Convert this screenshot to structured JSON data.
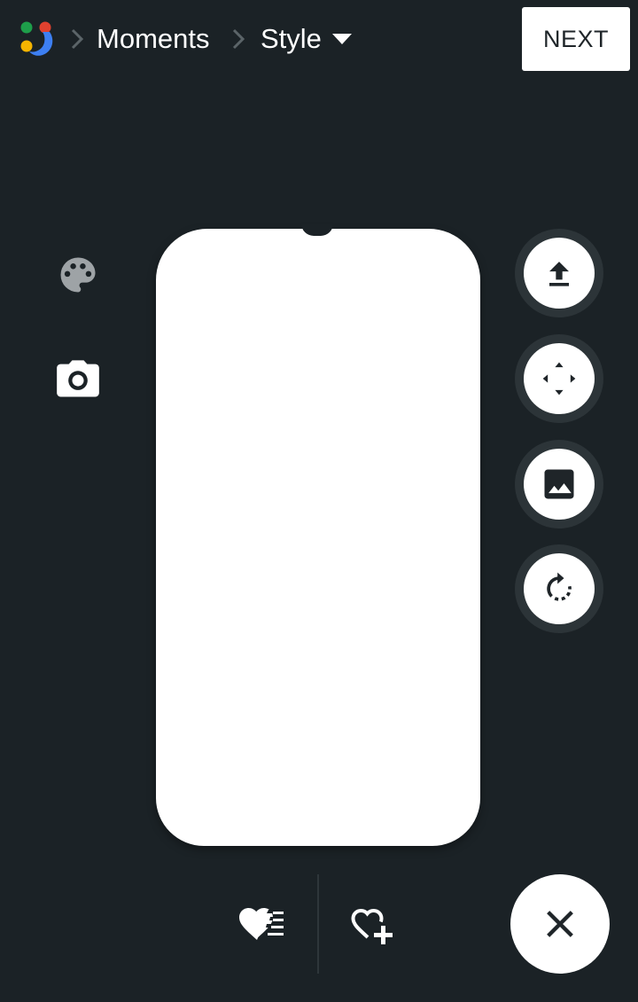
{
  "header": {
    "logo_icon": "app-logo-icon",
    "breadcrumb": [
      {
        "label": "Moments"
      },
      {
        "label": "Style",
        "has_dropdown": true
      }
    ],
    "next_label": "NEXT"
  },
  "left_tools": [
    {
      "icon": "palette-icon"
    },
    {
      "icon": "camera-icon"
    }
  ],
  "right_tools": [
    {
      "icon": "upload-icon"
    },
    {
      "icon": "move-arrows-icon"
    },
    {
      "icon": "image-icon"
    },
    {
      "icon": "rotate-icon"
    }
  ],
  "bottom_bar": {
    "icons": [
      "favorites-list-icon",
      "add-favorite-icon"
    ],
    "close_icon": "close-icon"
  },
  "colors": {
    "background": "#1b2226",
    "tool_ring": "#2c3438",
    "foreground": "#ffffff",
    "logo_green": "#1e9e4a",
    "logo_red": "#e0412f",
    "logo_yellow": "#f5b400",
    "logo_blue": "#3d7ff2"
  }
}
